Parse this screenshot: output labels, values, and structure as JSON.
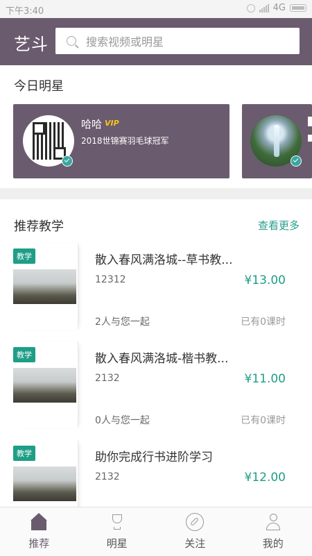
{
  "status_bar": {
    "time": "下午3:40",
    "network": "4G"
  },
  "header": {
    "logo": "艺斗",
    "search_placeholder": "搜索视频或明星"
  },
  "today_stars": {
    "title": "今日明星",
    "cards": [
      {
        "name": "哈哈",
        "badge": "VIP",
        "desc": "2018世锦赛羽毛球冠军"
      }
    ]
  },
  "recommend": {
    "title": "推荐教学",
    "more": "查看更多",
    "lessons": [
      {
        "tag": "教学",
        "title": "散入春风满洛城--草书教...",
        "sub": "12312",
        "price": "¥13.00",
        "with": "2人与您一起",
        "count": "已有0课时"
      },
      {
        "tag": "教学",
        "title": "散入春风满洛城-楷书教...",
        "sub": "2132",
        "price": "¥11.00",
        "with": "0人与您一起",
        "count": "已有0课时"
      },
      {
        "tag": "教学",
        "title": "助你完成行书进阶学习",
        "sub": "2132",
        "price": "¥12.00"
      }
    ]
  },
  "tabbar": {
    "tabs": [
      {
        "label": "推荐",
        "icon": "home-icon",
        "active": true
      },
      {
        "label": "明星",
        "icon": "trophy-icon"
      },
      {
        "label": "关注",
        "icon": "compass-icon"
      },
      {
        "label": "我的",
        "icon": "user-icon"
      }
    ]
  },
  "colors": {
    "brand": "#6b5b6e",
    "accent": "#1e9e86",
    "link": "#2a9d8f"
  }
}
